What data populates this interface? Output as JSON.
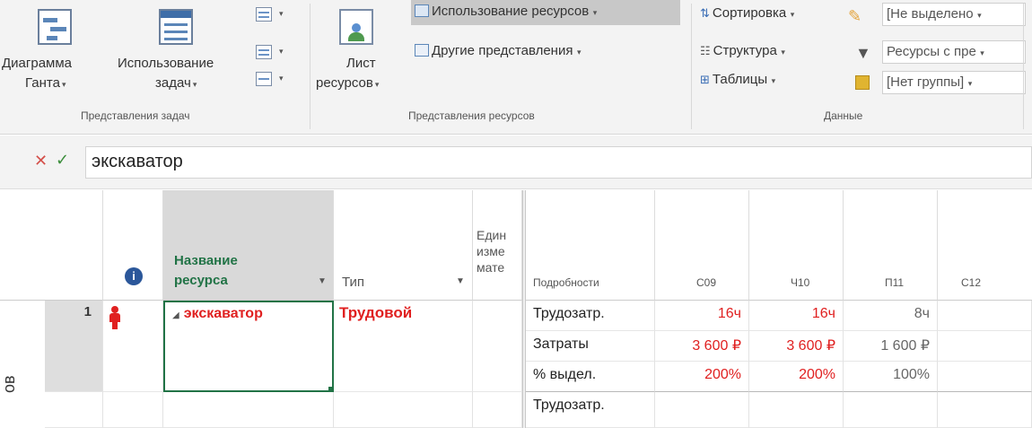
{
  "ribbon": {
    "gantt": {
      "line1": "Диаграмма",
      "line2": "Ганта"
    },
    "task_usage": {
      "line1": "Использование",
      "line2": "задач"
    },
    "resource_sheet": {
      "line1": "Лист",
      "line2": "ресурсов"
    },
    "resource_usage": "Использование ресурсов",
    "other_views": "Другие представления",
    "task_views_label": "Представления задач",
    "resource_views_label": "Представления ресурсов",
    "sort": "Сортировка",
    "outline": "Структура",
    "tables": "Таблицы",
    "highlight": "[Не выделено",
    "filter": "Ресурсы с пре",
    "group": "[Нет группы]",
    "data_label": "Данные"
  },
  "entry_bar": {
    "value": "экскаватор"
  },
  "side_label": "ов",
  "grid": {
    "headers": {
      "name": {
        "line1": "Название",
        "line2": "ресурса"
      },
      "type": "Тип",
      "units": {
        "line1": "Един",
        "line2": "изме",
        "line3": "мате"
      }
    },
    "rows": [
      {
        "id": "1",
        "name": "экскаватор",
        "type": "Трудовой"
      }
    ]
  },
  "timephased": {
    "details_header": "Подробности",
    "days": [
      "С09",
      "Ч10",
      "П11",
      "С12"
    ],
    "rows": [
      {
        "label": "Трудозатр.",
        "values": [
          "16ч",
          "16ч",
          "8ч",
          ""
        ]
      },
      {
        "label": "Затраты",
        "values": [
          "3 600 ₽",
          "3 600 ₽",
          "1 600 ₽",
          ""
        ]
      },
      {
        "label": "% выдел.",
        "values": [
          "200%",
          "200%",
          "100%",
          ""
        ]
      },
      {
        "label": "Трудозатр.",
        "values": [
          "",
          "",
          "",
          ""
        ]
      }
    ]
  },
  "colors": {
    "over_allocated": "#e02020",
    "accent_green": "#217346"
  }
}
